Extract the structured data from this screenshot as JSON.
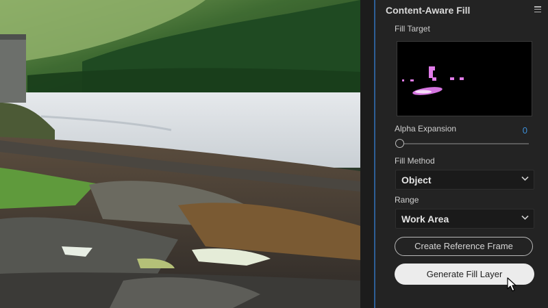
{
  "panel": {
    "title": "Content-Aware Fill",
    "menu_icon": "hamburger-menu-icon",
    "fill_target_label": "Fill Target",
    "alpha_expansion": {
      "label": "Alpha Expansion",
      "value": "0"
    },
    "fill_method": {
      "label": "Fill Method",
      "value": "Object"
    },
    "range": {
      "label": "Range",
      "value": "Work Area"
    },
    "buttons": {
      "create_reference_frame": "Create Reference Frame",
      "generate_fill_layer": "Generate Fill Layer"
    }
  },
  "colors": {
    "accent": "#3d8fd9",
    "panel_bg": "#232323",
    "mask_color": "#e07be8"
  }
}
